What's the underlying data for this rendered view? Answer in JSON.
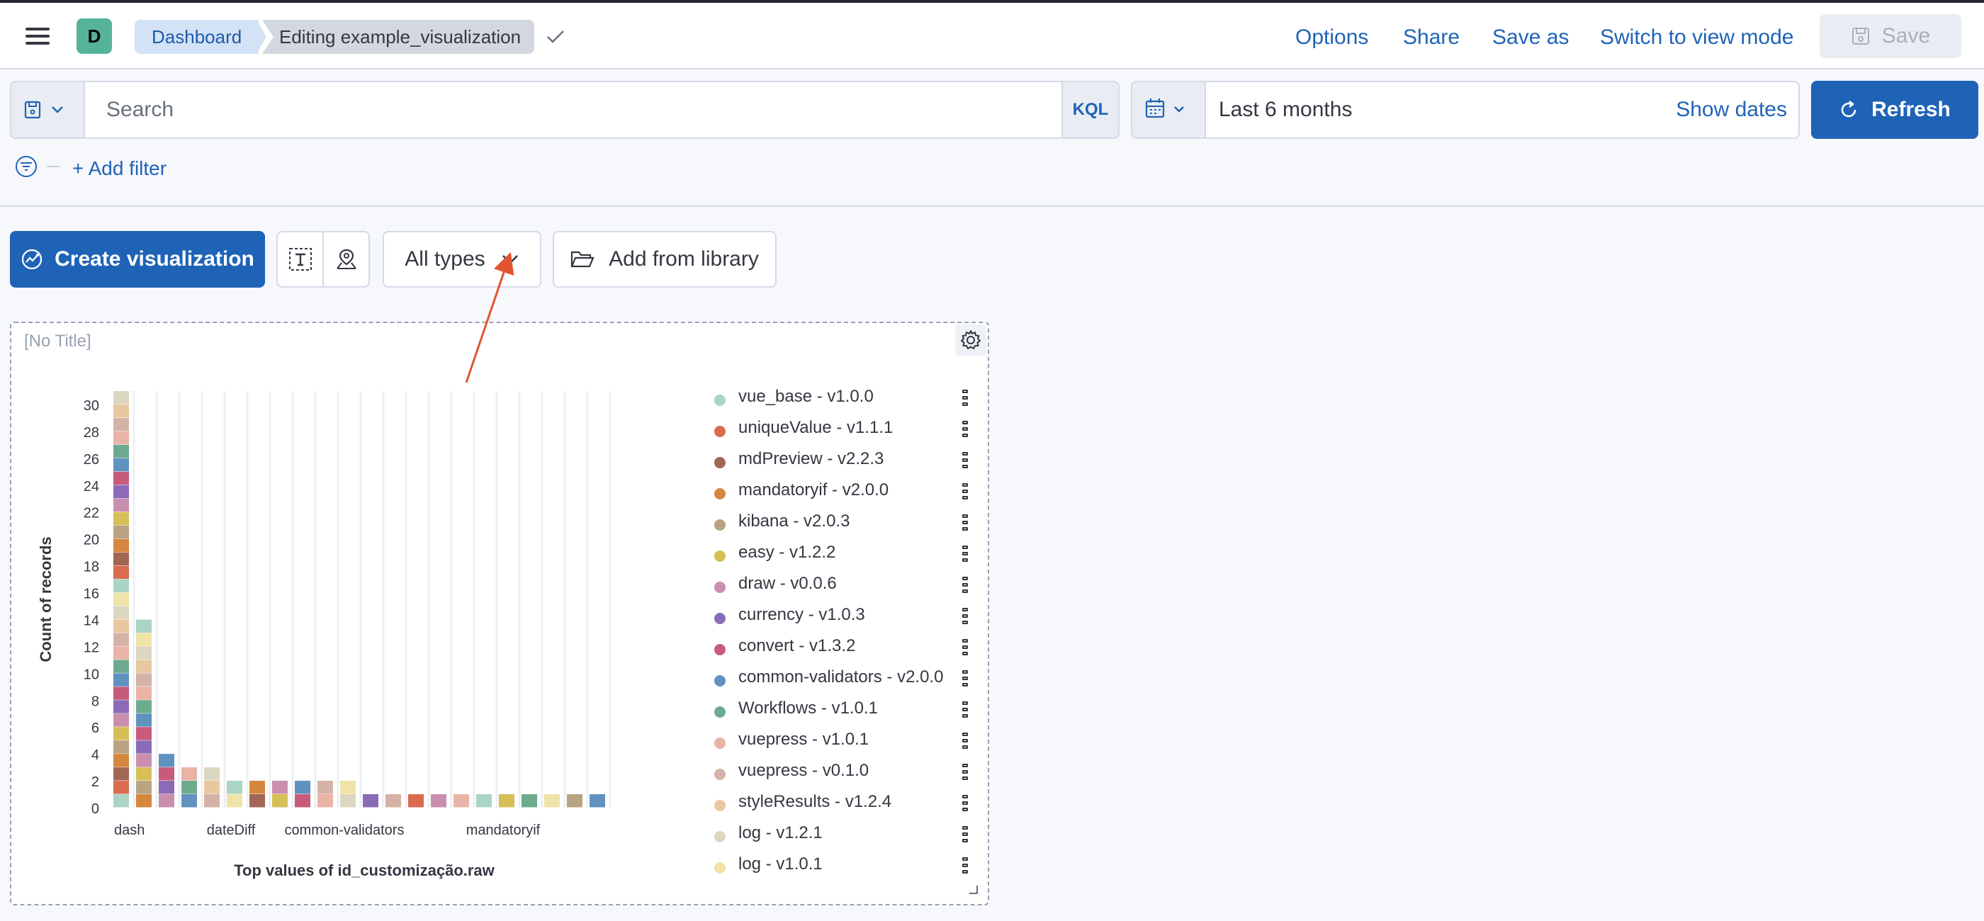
{
  "header": {
    "avatar_letter": "D",
    "breadcrumb_parent": "Dashboard",
    "breadcrumb_current": "Editing example_visualization",
    "links": {
      "options": "Options",
      "share": "Share",
      "save_as": "Save as",
      "switch_mode": "Switch to view mode"
    },
    "save_label": "Save"
  },
  "query": {
    "placeholder": "Search",
    "language": "KQL"
  },
  "date": {
    "range": "Last 6 months",
    "show_dates": "Show dates"
  },
  "refresh_label": "Refresh",
  "filter": {
    "add_label": "+ Add filter"
  },
  "toolbar": {
    "create_label": "Create visualization",
    "types_label": "All types",
    "library_label": "Add from library"
  },
  "annotation": {
    "color": "#e0552f"
  },
  "panel": {
    "title": "[No Title]"
  },
  "chart_data": {
    "type": "bar",
    "stacked": true,
    "ylabel": "Count of records",
    "xlabel": "Top values of id_customização.raw",
    "ylim": [
      0,
      31
    ],
    "yticks": [
      0,
      2,
      4,
      6,
      8,
      10,
      12,
      14,
      16,
      18,
      20,
      22,
      24,
      26,
      28,
      30
    ],
    "visible_category_labels": [
      "dash",
      "dateDiff",
      "common-validators",
      "mandatoryif"
    ],
    "bar_totals": [
      31,
      14,
      4,
      3,
      3,
      2,
      2,
      2,
      2,
      2,
      2,
      1,
      1,
      1,
      1,
      1,
      1,
      1,
      1,
      1,
      1,
      1
    ],
    "grid": "vertical",
    "legend_position": "right"
  },
  "legend": {
    "items": [
      {
        "label": "vue_base - v1.0.0",
        "color": "#aad4c4"
      },
      {
        "label": "uniqueValue - v1.1.1",
        "color": "#da6b4f"
      },
      {
        "label": "mdPreview - v2.2.3",
        "color": "#a26654"
      },
      {
        "label": "mandatoryif - v2.0.0",
        "color": "#d6873e"
      },
      {
        "label": "kibana - v2.0.3",
        "color": "#b8a383"
      },
      {
        "label": "easy - v1.2.2",
        "color": "#d6bf57"
      },
      {
        "label": "draw - v0.0.6",
        "color": "#ca8eae"
      },
      {
        "label": "currency - v1.0.3",
        "color": "#8b6bb8"
      },
      {
        "label": "convert - v1.3.2",
        "color": "#c85a7a"
      },
      {
        "label": "common-validators - v2.0.0",
        "color": "#6092c0"
      },
      {
        "label": "Workflows - v1.0.1",
        "color": "#6dab8f"
      },
      {
        "label": "vuepress - v1.0.1",
        "color": "#eab3a8"
      },
      {
        "label": "vuepress - v0.1.0",
        "color": "#d4b2a7"
      },
      {
        "label": "styleResults - v1.2.4",
        "color": "#e9c7a0"
      },
      {
        "label": "log - v1.2.1",
        "color": "#dcd7c1"
      },
      {
        "label": "log - v1.0.1",
        "color": "#f0e3a8"
      }
    ]
  }
}
